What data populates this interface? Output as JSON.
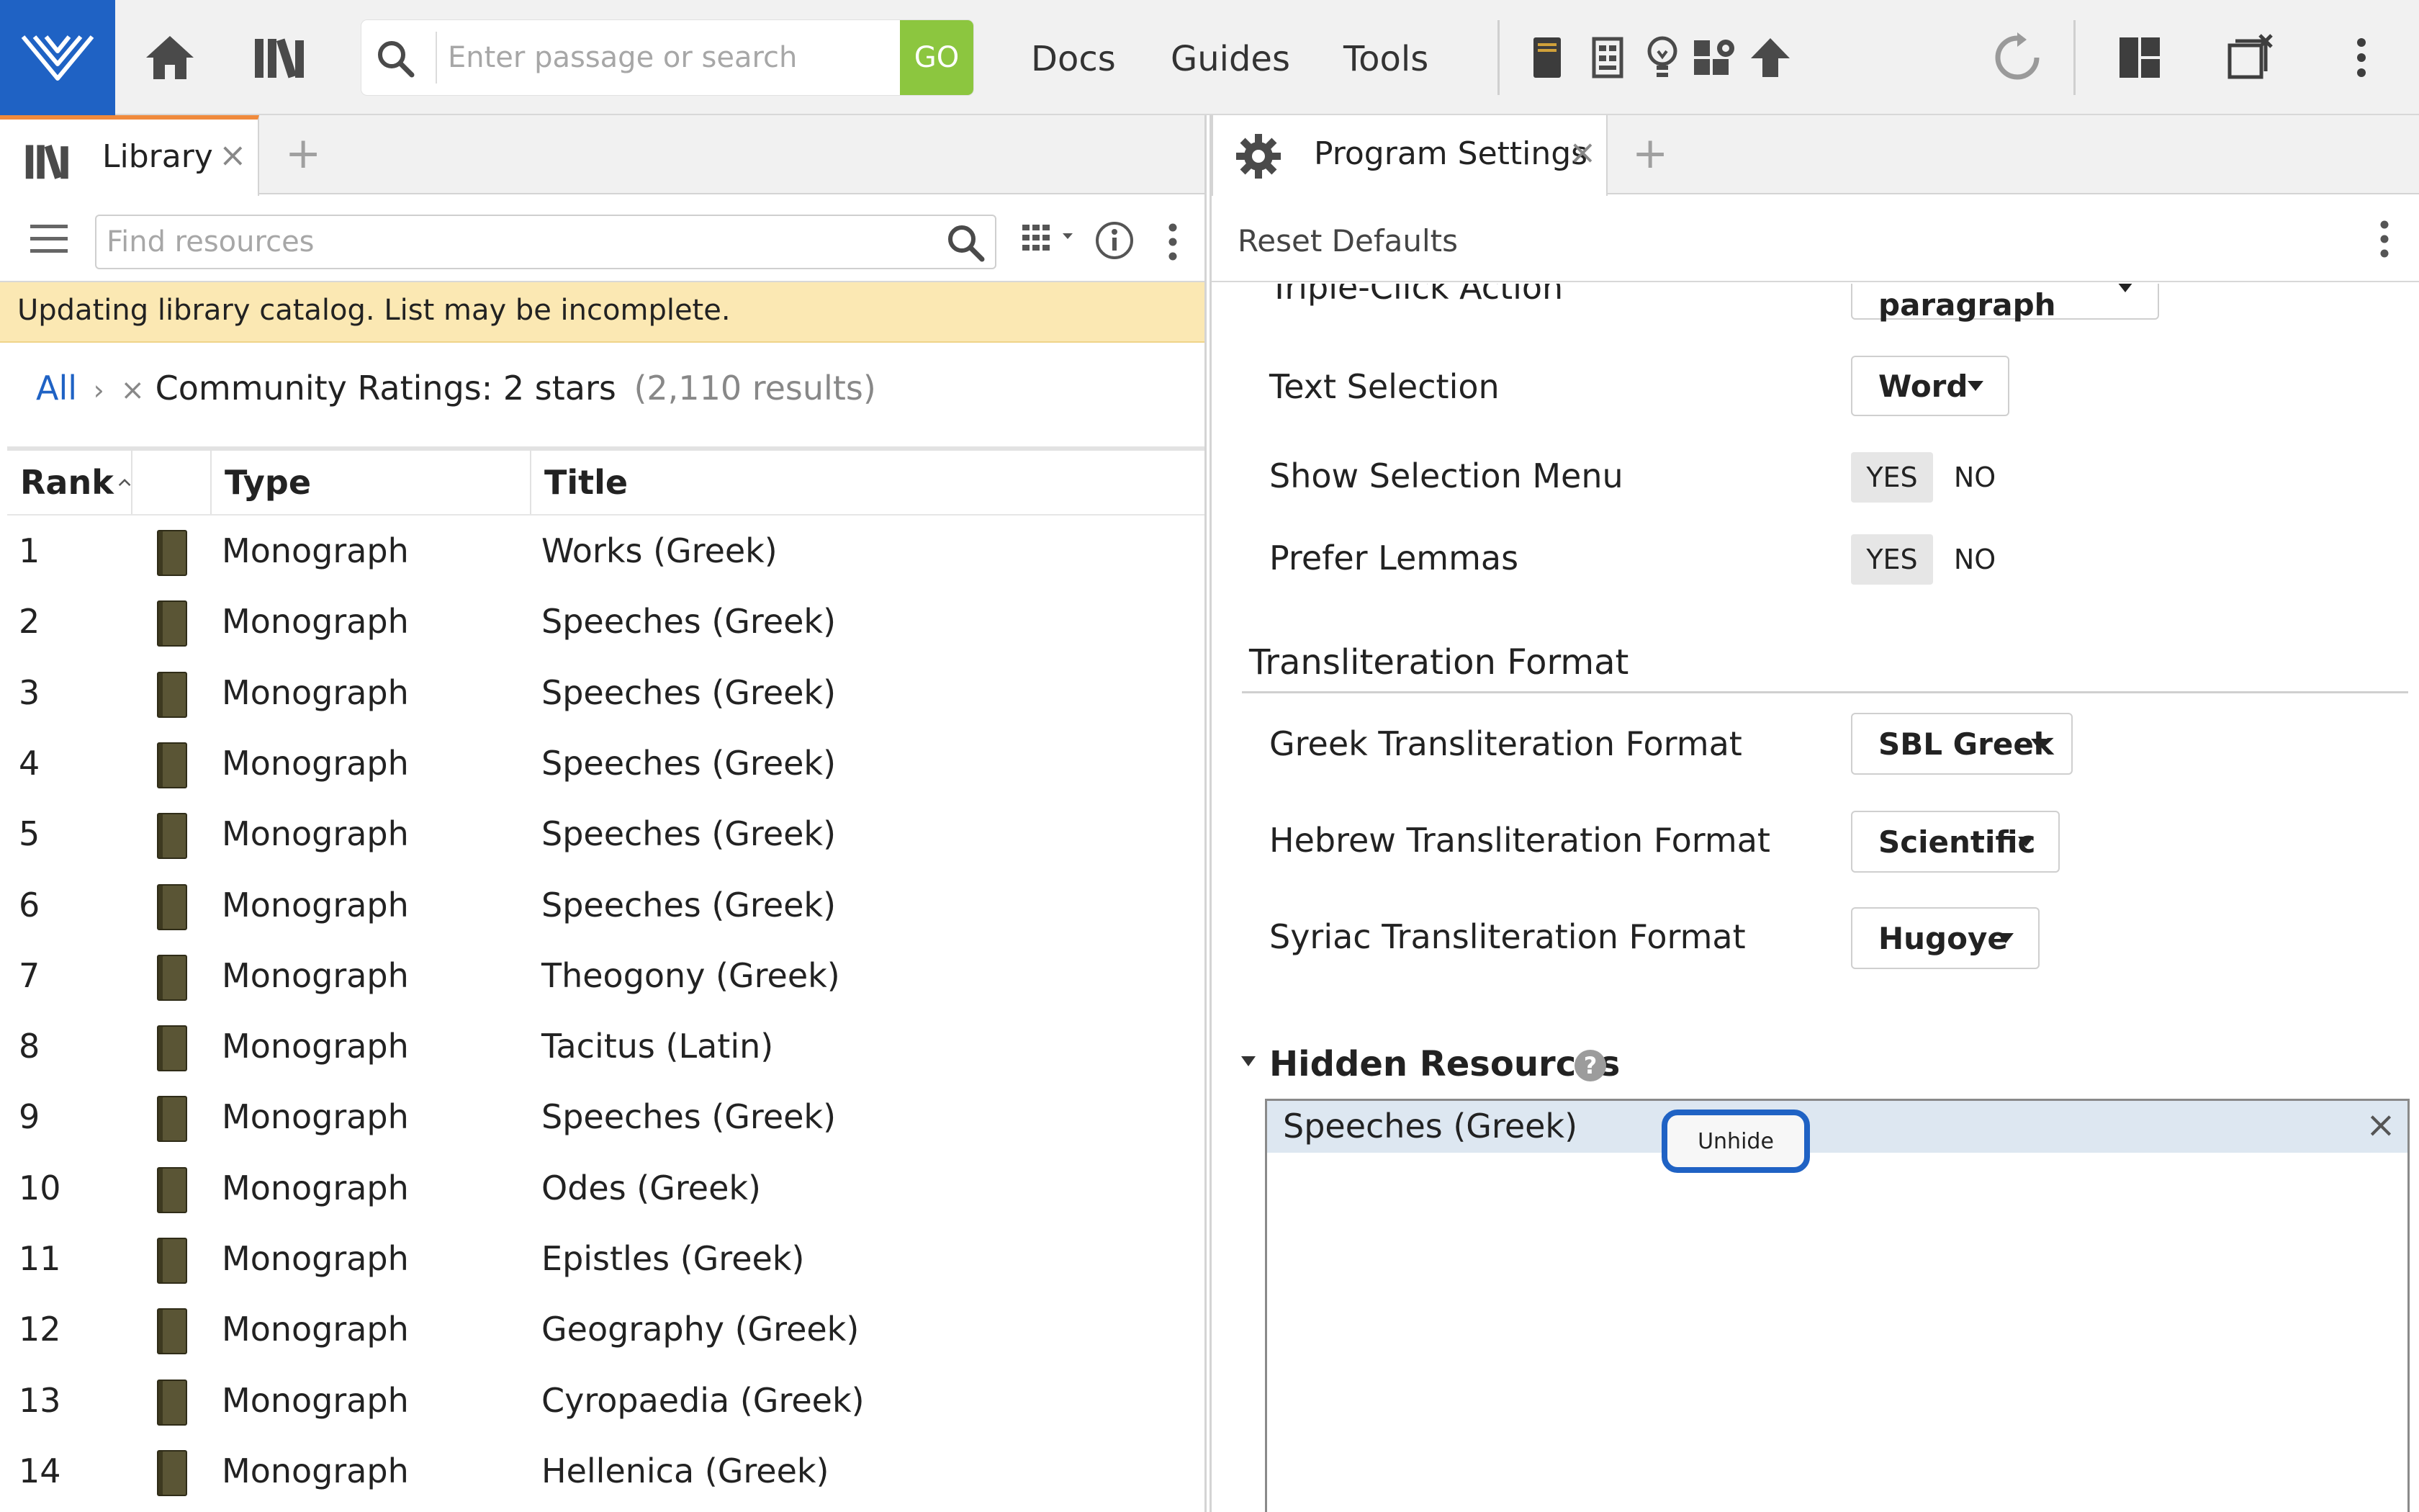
{
  "topbar": {
    "search_placeholder": "Enter passage or search",
    "go_label": "GO",
    "nav": [
      "Docs",
      "Guides",
      "Tools"
    ]
  },
  "library": {
    "tab_label": "Library",
    "find_placeholder": "Find resources",
    "banner": "Updating library catalog. List may be incomplete.",
    "breadcrumb": {
      "all": "All",
      "separator": "›",
      "remove": "×",
      "filter": "Community Ratings: 2 stars",
      "count": "(2,110 results)"
    },
    "columns": {
      "rank": "Rank",
      "type": "Type",
      "title": "Title"
    },
    "rows": [
      {
        "rank": "1",
        "type": "Monograph",
        "title": "Works (Greek)"
      },
      {
        "rank": "2",
        "type": "Monograph",
        "title": "Speeches (Greek)"
      },
      {
        "rank": "3",
        "type": "Monograph",
        "title": "Speeches (Greek)"
      },
      {
        "rank": "4",
        "type": "Monograph",
        "title": "Speeches (Greek)"
      },
      {
        "rank": "5",
        "type": "Monograph",
        "title": "Speeches (Greek)"
      },
      {
        "rank": "6",
        "type": "Monograph",
        "title": "Speeches (Greek)"
      },
      {
        "rank": "7",
        "type": "Monograph",
        "title": "Theogony (Greek)"
      },
      {
        "rank": "8",
        "type": "Monograph",
        "title": "Tacitus (Latin)"
      },
      {
        "rank": "9",
        "type": "Monograph",
        "title": "Speeches (Greek)"
      },
      {
        "rank": "10",
        "type": "Monograph",
        "title": "Odes (Greek)"
      },
      {
        "rank": "11",
        "type": "Monograph",
        "title": "Epistles (Greek)"
      },
      {
        "rank": "12",
        "type": "Monograph",
        "title": "Geography (Greek)"
      },
      {
        "rank": "13",
        "type": "Monograph",
        "title": "Cyropaedia (Greek)"
      },
      {
        "rank": "14",
        "type": "Monograph",
        "title": "Hellenica (Greek)"
      }
    ]
  },
  "settings": {
    "tab_label": "Program Settings",
    "reset_label": "Reset Defaults",
    "triple_click": {
      "label": "Triple-Click Action",
      "value": "Select paragraph"
    },
    "text_selection": {
      "label": "Text Selection",
      "value": "Word"
    },
    "show_selection_menu": {
      "label": "Show Selection Menu",
      "yes": "YES",
      "no": "NO"
    },
    "prefer_lemmas": {
      "label": "Prefer Lemmas",
      "yes": "YES",
      "no": "NO"
    },
    "translit_section": "Transliteration Format",
    "greek": {
      "label": "Greek Transliteration Format",
      "value": "SBL Greek"
    },
    "hebrew": {
      "label": "Hebrew Transliteration Format",
      "value": "Scientific"
    },
    "syriac": {
      "label": "Syriac Transliteration Format",
      "value": "Hugoye"
    },
    "hidden_section": "Hidden Resources",
    "help": "?",
    "hidden_item": "Speeches (Greek)",
    "unhide_label": "Unhide",
    "remove_glyph": "×"
  },
  "colors": {
    "brand_blue": "#1f62c4",
    "go_green": "#8cc63f",
    "banner_yellow": "#fbe8b3",
    "active_tab_accent": "#f08a3c"
  }
}
